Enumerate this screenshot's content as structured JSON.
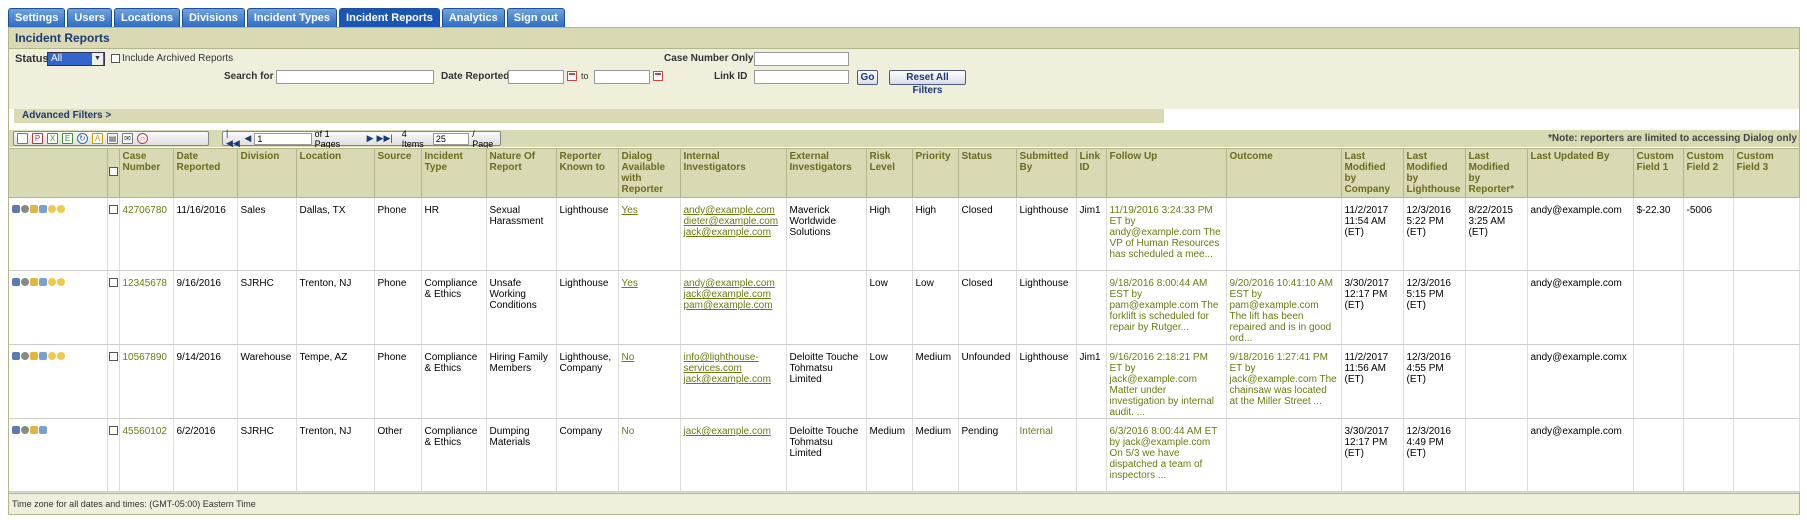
{
  "tabs": [
    "Settings",
    "Users",
    "Locations",
    "Divisions",
    "Incident Types",
    "Incident Reports",
    "Analytics",
    "Sign out"
  ],
  "active_tab": 5,
  "panel_title": "Incident Reports",
  "filters": {
    "status_label": "Status",
    "status_value": "All",
    "include_archived_label": "Include Archived Reports",
    "case_number_label": "Case Number Only",
    "search_label": "Search for",
    "date_reported_label": "Date Reported",
    "to_label": "to",
    "link_id_label": "Link ID",
    "go_label": "Go",
    "reset_label": "Reset All Filters",
    "advanced_label": "Advanced Filters >"
  },
  "pager": {
    "page_value": "1",
    "of_pages": "of 1 Pages",
    "items": "4 Items",
    "per_page_value": "25",
    "per_page_label": "/ Page"
  },
  "note": "*Note: reporters are limited to accessing Dialog only",
  "columns": [
    "Case Number",
    "Date Reported",
    "Division",
    "Location",
    "Source",
    "Incident Type",
    "Nature Of Report",
    "Reporter Known to",
    "Dialog Available with Reporter",
    "Internal Investigators",
    "External Investigators",
    "Risk Level",
    "Priority",
    "Status",
    "Submitted By",
    "Link ID",
    "Follow Up",
    "Outcome",
    "Last Modified by Company",
    "Last Modified by Lighthouse",
    "Last Modified by Reporter*",
    "Last Updated By",
    "Custom Field 1",
    "Custom Field 2",
    "Custom Field 3"
  ],
  "rows": [
    {
      "case": "42706780",
      "date": "11/16/2016",
      "division": "Sales",
      "location": "Dallas, TX",
      "source": "Phone",
      "type": "HR",
      "nature": "Sexual Harassment",
      "known": "Lighthouse",
      "dialog": "Yes",
      "internal": [
        "andy@example.com",
        "dieter@example.com",
        "jack@example.com"
      ],
      "external": "Maverick Worldwide Solutions",
      "risk": "High",
      "priority": "High",
      "status": "Closed",
      "submitted": "Lighthouse",
      "link": "Jim1",
      "followup": "11/19/2016 3:24:33 PM ET by andy@example.com The VP of Human Resources has scheduled a mee...",
      "outcome": "",
      "mod_company": "11/2/2017 11:54 AM (ET)",
      "mod_lighthouse": "12/3/2016 5:22 PM (ET)",
      "mod_reporter": "8/22/2015 3:25 AM (ET)",
      "updated_by": "andy@example.com",
      "cf1": "$-22.30",
      "cf2": "-5006",
      "cf3": ""
    },
    {
      "case": "12345678",
      "date": "9/16/2016",
      "division": "SJRHC",
      "location": "Trenton, NJ",
      "source": "Phone",
      "type": "Compliance & Ethics",
      "nature": "Unsafe Working Conditions",
      "known": "Lighthouse",
      "dialog": "Yes",
      "internal": [
        "andy@example.com",
        "jack@example.com",
        "pam@example.com"
      ],
      "external": "",
      "risk": "Low",
      "priority": "Low",
      "status": "Closed",
      "submitted": "Lighthouse",
      "link": "",
      "followup": "9/18/2016 8:00:44 AM EST by pam@example.com The forklift is scheduled for repair by Rutger...",
      "outcome": "9/20/2016 10:41:10 AM EST by pam@example.com The lift has been repaired and is in good ord...",
      "mod_company": "3/30/2017 12:17 PM (ET)",
      "mod_lighthouse": "12/3/2016 5:15 PM (ET)",
      "mod_reporter": "",
      "updated_by": "andy@example.com",
      "cf1": "",
      "cf2": "",
      "cf3": ""
    },
    {
      "case": "10567890",
      "date": "9/14/2016",
      "division": "Warehouse",
      "location": "Tempe, AZ",
      "source": "Phone",
      "type": "Compliance & Ethics",
      "nature": "Hiring Family Members",
      "known": "Lighthouse, Company",
      "dialog": "No",
      "internal": [
        "info@lighthouse-services.com",
        "jack@example.com"
      ],
      "external": "Deloitte Touche Tohmatsu Limited",
      "risk": "Low",
      "priority": "Medium",
      "status": "Unfounded",
      "submitted": "Lighthouse",
      "link": "Jim1",
      "followup": "9/16/2016 2:18:21 PM ET by jack@example.com Matter under investigation by internal audit. ...",
      "outcome": "9/18/2016 1:27:41 PM ET by jack@example.com The chainsaw was located at the Miller Street ...",
      "mod_company": "11/2/2017 11:56 AM (ET)",
      "mod_lighthouse": "12/3/2016 4:55 PM (ET)",
      "mod_reporter": "",
      "updated_by": "andy@example.comx",
      "cf1": "",
      "cf2": "",
      "cf3": ""
    },
    {
      "case": "45560102",
      "date": "6/2/2016",
      "division": "SJRHC",
      "location": "Trenton, NJ",
      "source": "Other",
      "type": "Compliance & Ethics",
      "nature": "Dumping Materials",
      "known": "Company",
      "dialog": "No",
      "internal": [
        "jack@example.com"
      ],
      "external": "Deloitte Touche Tohmatsu Limited",
      "risk": "Medium",
      "priority": "Medium",
      "status": "Pending",
      "submitted": "Internal",
      "link": "",
      "followup": "6/3/2016 8:00:44 AM ET by jack@example.com On 5/3 we have dispatched a team of inspectors ...",
      "outcome": "",
      "mod_company": "3/30/2017 12:17 PM (ET)",
      "mod_lighthouse": "12/3/2016 4:49 PM (ET)",
      "mod_reporter": "",
      "updated_by": "andy@example.com",
      "cf1": "",
      "cf2": "",
      "cf3": ""
    }
  ],
  "footer": "Time zone for all dates and times: (GMT-05:00) Eastern Time"
}
